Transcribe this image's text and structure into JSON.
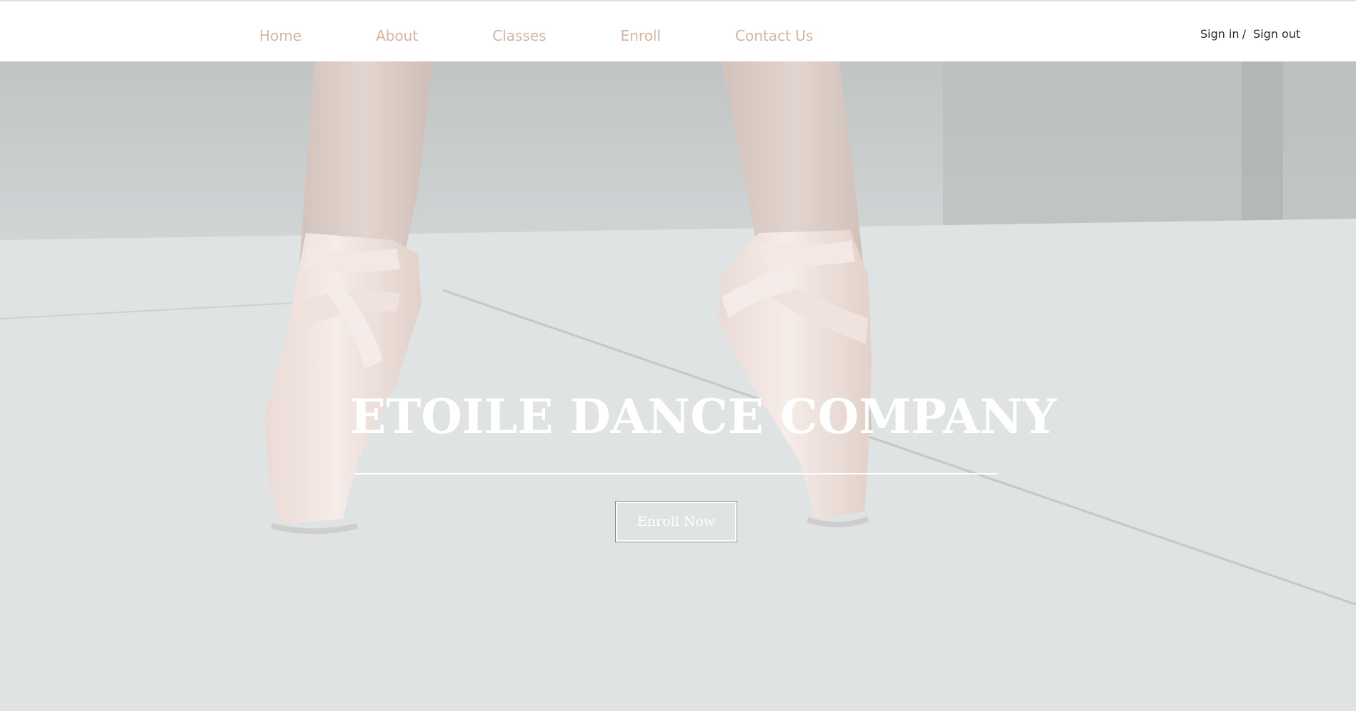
{
  "nav": {
    "links": [
      {
        "label": "Home"
      },
      {
        "label": "About"
      },
      {
        "label": "Classes"
      },
      {
        "label": "Enroll"
      },
      {
        "label": "Contact Us"
      }
    ],
    "sign_in": "Sign in",
    "separator": "/",
    "sign_out": "Sign out"
  },
  "hero": {
    "title": "ETOILE DANCE COMPANY",
    "cta_label": "Enroll Now"
  },
  "colors": {
    "nav_link": "#d4b5a2",
    "auth_text": "#2a2a2a",
    "hero_text": "#ffffff",
    "pointe_shoe": "#ead9d3"
  }
}
